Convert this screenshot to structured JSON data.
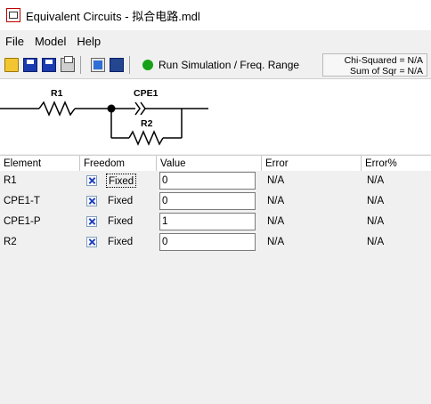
{
  "window": {
    "title": "Equivalent Circuits - 拟合电路.mdl"
  },
  "menu": {
    "items": [
      "File",
      "Model",
      "Help"
    ]
  },
  "toolbar": {
    "run_label": "Run Simulation / Freq. Range",
    "chi_squared": "Chi-Squared = N/A",
    "sum_of_sqr": "Sum of Sqr = N/A",
    "icons": [
      "open-folder-icon",
      "save-icon",
      "save-as-icon",
      "print-icon",
      "circuit-tool-icon",
      "fit-save-icon",
      "run-indicator-icon"
    ],
    "run_indicator_color": "#17a018"
  },
  "circuit": {
    "labels": {
      "r1": "R1",
      "cpe1": "CPE1",
      "r2": "R2"
    }
  },
  "table": {
    "headers": [
      "Element",
      "Freedom",
      "Value",
      "Error",
      "Error%"
    ],
    "rows": [
      {
        "element": "R1",
        "freedom": "Fixed",
        "value": "0",
        "error": "N/A",
        "error_pct": "N/A"
      },
      {
        "element": "CPE1-T",
        "freedom": "Fixed",
        "value": "0",
        "error": "N/A",
        "error_pct": "N/A"
      },
      {
        "element": "CPE1-P",
        "freedom": "Fixed",
        "value": "1",
        "error": "N/A",
        "error_pct": "N/A"
      },
      {
        "element": "R2",
        "freedom": "Fixed",
        "value": "0",
        "error": "N/A",
        "error_pct": "N/A"
      }
    ]
  }
}
